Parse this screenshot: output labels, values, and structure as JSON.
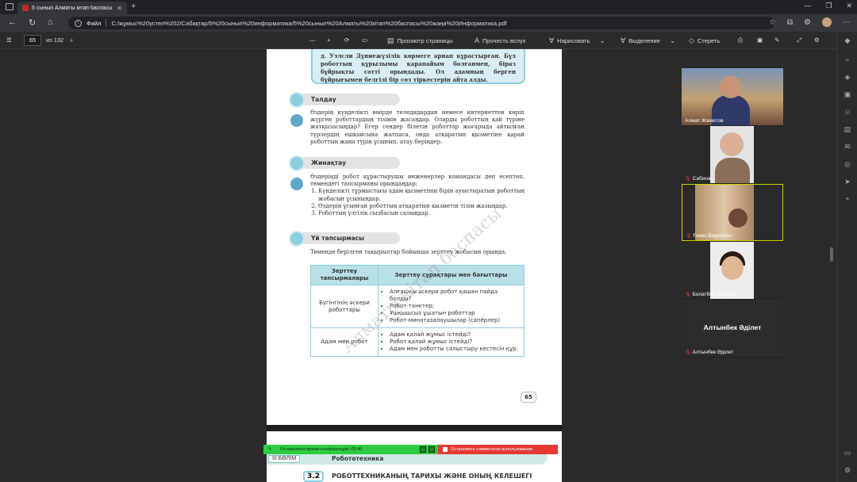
{
  "browser": {
    "tab_title": "5 сынып Алматы кітап баспасы",
    "new_tab": "+",
    "url_prefix": "Файл",
    "url": "C:/жұмыс%20үстел%202/Сабақтар/5%20сынып%20информатика/5%20сынып%20Алматы%20кітап%20баспасы%20жаңа%20Информатика.pdf"
  },
  "pdf_toolbar": {
    "current_page": "65",
    "total_pages": "из 132",
    "page_view": "Просмотр страницы",
    "read_aloud": "Прочесть вслух",
    "draw": "Нарисовать",
    "highlight": "Выделение",
    "erase": "Стереть"
  },
  "page": {
    "callout_text": "д. Уэлсли Дүниежүзілік көрмеге арнап құрастырған. Бұл роботтың құрылымы қарапайым болғанмен, біраз бұйрықты сәтті орындады. Ол адамның берген бұйрығымен белгілі бір сөз тіркестерін айта алды.",
    "section1_title": "Талдау",
    "section1_text": "Өздерің күнделікті өмірде теледидардан немесе интернеттен көріп жүрген роботтардың тізімін жасаңдар. Оларды роботтың қай түріне жатқызасыңдар? Егер сендер білетін роботтар жоғарыда айтылған түрлердің ешқайсына жатпаса, онда атқаратын қызметіне қарай роботтың жаңа түрін ұсынып, атау беріңдер.",
    "section2_title": "Жинақтау",
    "section2_intro": "Өздеріңді робот құрастырушы инженерлер командасы деп есептеп, төмендегі тапсырманы орындаңдар:",
    "section2_items": [
      "Күнделікті тұрмыстағы адам қызметінің бірін ауыстыратын роботтың жобасын ұсыныңдар.",
      "Өздерің ұсынған роботтың атқаратын қызметін тізім жазыңдар.",
      "Роботтың үлгілік сызбасын салыңдар."
    ],
    "section3_title": "Үй тапсырмасы",
    "section3_text": "Төменде берілген тақырыптар бойынша зерттеу жобасын орында.",
    "table": {
      "header_col1": "Зерттеу тапсырмалары",
      "header_col2": "Зерттеу сұрақтары мен бағыттары",
      "rows": [
        {
          "topic": "Бүгінгінің әскери роботтары",
          "items": [
            "Алғашқы әскери робот қашан пайда болды?",
            "Робот-танктер;",
            "Ұшқышсыз ұшатын роботтар",
            "Робот-минатазалаушылар (сапёрлер)"
          ]
        },
        {
          "topic": "Адам мен робот",
          "items": [
            "Адам қалай жұмыс істейді?",
            "Робот қалай жұмыс істейді?",
            "Адам мен роботты салыстыру кестесін құр."
          ]
        }
      ]
    },
    "page_number": "65",
    "watermark": "Алматы кітап баспасы"
  },
  "page2": {
    "part_label": "III БӨЛІМ",
    "part_title": "Робототехника",
    "chapter_num": "3.2",
    "chapter_title": "РОБОТТЕХНИКАНЫҢ ТАРИХЫ ЖӘНЕ ОНЫҢ КЕЛЕШЕГІ"
  },
  "conference": {
    "remaining": "Оставшееся время конференции: 05:46",
    "stop_share": "Остановить совместное использование"
  },
  "participants": {
    "p1": "Алмат Жамитов",
    "p2": "Сабина",
    "p3": "Ғазиз Ваурожан",
    "p4": "Болатбек Томирис",
    "p5_big": "Алтынбек Әділет",
    "p5": "Алтынбек Әділет"
  }
}
